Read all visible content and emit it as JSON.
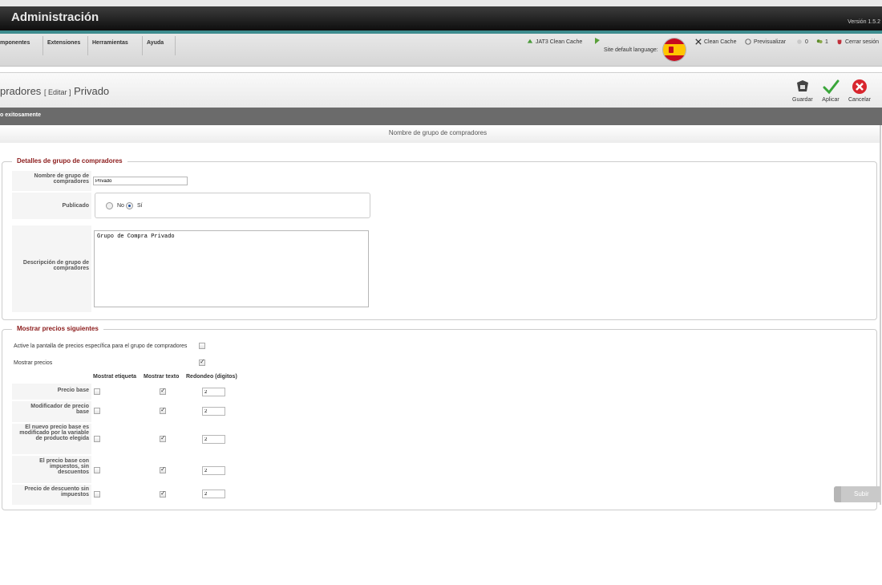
{
  "header": {
    "title": "Administración",
    "version": "Versión 1.5.2"
  },
  "menubar": {
    "items": [
      "mponentes",
      "Extensiones",
      "Herramientas",
      "Ayuda"
    ],
    "jat3_cache": "JAT3 Clean Cache",
    "site_language_label": "Site default language:",
    "clean_cache": "Clean Cache",
    "preview": "Previsualizar",
    "visitors_count": "0",
    "admins_count": "1",
    "logout": "Cerrar sesión"
  },
  "toolbar": {
    "title_main": "pradores",
    "title_action": "[ Editar ]",
    "title_item": "Privado",
    "save": "Guardar",
    "apply": "Aplicar",
    "cancel": "Cancelar"
  },
  "message": "o exitosamente",
  "tab_header": "Nombre de grupo de compradores",
  "details": {
    "legend": "Detalles de grupo de compradores",
    "name_label": "Nombre de grupo de compradores",
    "name_value": "Privado",
    "published_label": "Publicado",
    "published_no": "No",
    "published_yes": "Sí",
    "published_value": "Sí",
    "description_label": "Descripción de grupo de compradores",
    "description_value": "Grupo de Compra Privado"
  },
  "prices": {
    "legend": "Mostrar precios siguientes",
    "activate_label": "Active la pantalla de precios específica para el grupo de compradores",
    "activate_checked": false,
    "show_prices_label": "Mostrar precios",
    "show_prices_checked": true,
    "columns": [
      "Mostrat etiqueta",
      "Mostrar texto",
      "Redondeo (digitos)"
    ],
    "rows": [
      {
        "label": "Precio base",
        "show_label": false,
        "show_text": true,
        "rounding": "2"
      },
      {
        "label": "Modificador de precio base",
        "show_label": false,
        "show_text": true,
        "rounding": "2"
      },
      {
        "label": "El nuevo precio base es modificado por la variable de producto elegida",
        "show_label": false,
        "show_text": true,
        "rounding": "2"
      },
      {
        "label": "El precio base con impuestos, sin descuentos",
        "show_label": false,
        "show_text": true,
        "rounding": "2"
      },
      {
        "label": "Precio de descuento sin impuestos",
        "show_label": false,
        "show_text": true,
        "rounding": "2"
      }
    ]
  },
  "scroll_up": "Subir",
  "colors": {
    "accent": "#3d8c8e",
    "legend": "#8b1a1a",
    "header": "#1a1a1a"
  }
}
